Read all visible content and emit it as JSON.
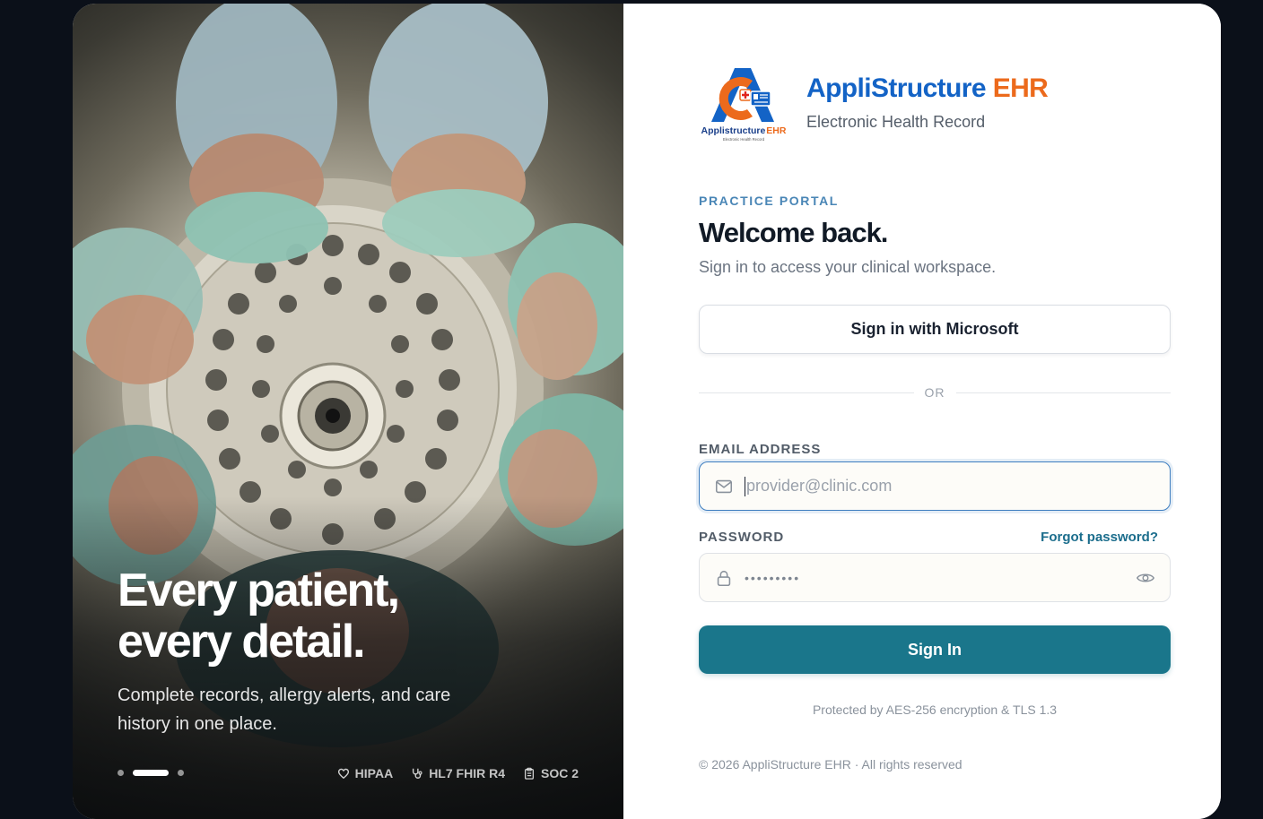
{
  "hero": {
    "title_line1": "Every patient,",
    "title_line2": "every detail.",
    "subtitle": "Complete records, allergy alerts, and care history in one place.",
    "carousel": {
      "total": 3,
      "active": 2
    },
    "badges": [
      {
        "label": "HIPAA",
        "icon": "heart-icon"
      },
      {
        "label": "HL7 FHIR R4",
        "icon": "stethoscope-icon"
      },
      {
        "label": "SOC 2",
        "icon": "clipboard-icon"
      }
    ]
  },
  "brand": {
    "name_main": "AppliStructure",
    "name_accent": "EHR",
    "tagline": "Electronic Health Record",
    "logo_caption": "Applistructure",
    "logo_caption_accent": "EHR",
    "logo_subcaption": "Electronic Health Record",
    "colors": {
      "blue": "#1363c6",
      "orange": "#ec6a1c"
    }
  },
  "form": {
    "eyebrow": "PRACTICE PORTAL",
    "heading": "Welcome back.",
    "subheading": "Sign in to access your clinical workspace.",
    "microsoft_button": "Sign in with Microsoft",
    "divider": "OR",
    "email_label": "EMAIL ADDRESS",
    "email_placeholder": "provider@clinic.com",
    "email_value": "",
    "password_label": "PASSWORD",
    "forgot_link": "Forgot password?",
    "password_mask": "•••••••••",
    "submit": "Sign In",
    "accent_color": "#1a768b"
  },
  "footer": {
    "security_note": "Protected by AES-256 encryption & TLS 1.3",
    "copyright": "© 2026 AppliStructure EHR · All rights reserved"
  }
}
